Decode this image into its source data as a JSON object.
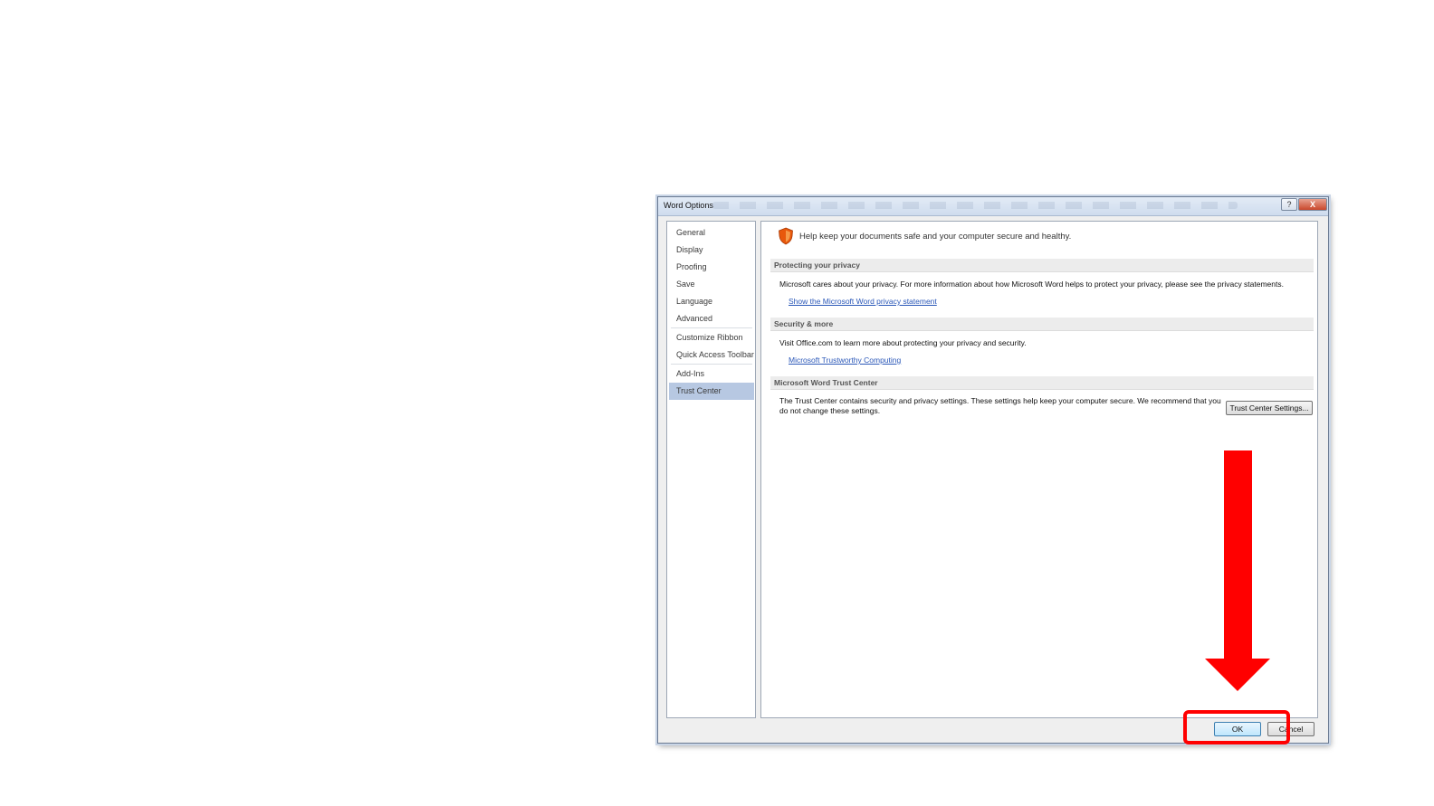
{
  "window": {
    "title": "Word Options",
    "help_label": "?",
    "close_label": "X"
  },
  "nav": {
    "items": [
      {
        "label": "General"
      },
      {
        "label": "Display"
      },
      {
        "label": "Proofing"
      },
      {
        "label": "Save"
      },
      {
        "label": "Language"
      },
      {
        "label": "Advanced"
      },
      {
        "label": "Customize Ribbon"
      },
      {
        "label": "Quick Access Toolbar"
      },
      {
        "label": "Add-Ins"
      },
      {
        "label": "Trust Center"
      }
    ],
    "selected": "Trust Center"
  },
  "content": {
    "intro": "Help keep your documents safe and your computer secure and healthy.",
    "privacy": {
      "header": "Protecting your privacy",
      "text": "Microsoft cares about your privacy. For more information about how Microsoft Word helps to protect your privacy, please see the privacy statements.",
      "link": "Show the Microsoft Word privacy statement"
    },
    "security": {
      "header": "Security & more",
      "text": "Visit Office.com to learn more about protecting your privacy and security.",
      "link": "Microsoft Trustworthy Computing"
    },
    "trust_center": {
      "header": "Microsoft Word Trust Center",
      "text": "The Trust Center contains security and privacy settings. These settings help keep your computer secure. We recommend that you do not change these settings.",
      "button": "Trust Center Settings..."
    }
  },
  "footer": {
    "ok": "OK",
    "cancel": "Cancel"
  },
  "annotation": {
    "color": "#ff0000"
  },
  "icons": {
    "shield": "shield-icon",
    "help": "help-icon",
    "close": "close-icon"
  }
}
